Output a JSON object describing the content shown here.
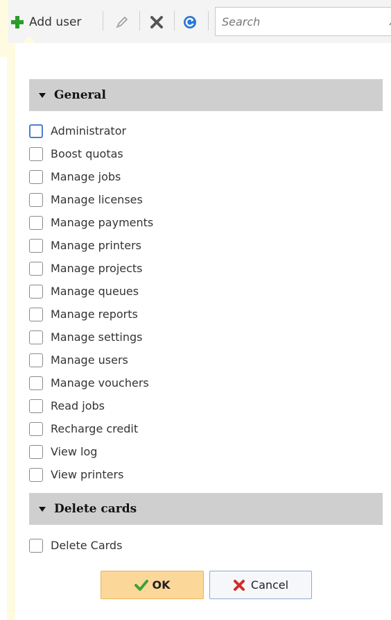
{
  "toolbar": {
    "add_user_label": "Add user",
    "search_placeholder": "Search",
    "icons": [
      "plus-icon",
      "pencil-icon",
      "delete-x-icon",
      "refresh-icon",
      "search-icon"
    ],
    "colors": {
      "plus": "#2a9d2a",
      "delete": "#555555",
      "refresh": "#2b78d6"
    }
  },
  "dialog": {
    "sections": [
      {
        "title": "General",
        "permissions": [
          "Administrator",
          "Boost quotas",
          "Manage jobs",
          "Manage licenses",
          "Manage payments",
          "Manage printers",
          "Manage projects",
          "Manage queues",
          "Manage reports",
          "Manage settings",
          "Manage users",
          "Manage vouchers",
          "Read jobs",
          "Recharge credit",
          "View log",
          "View printers"
        ]
      },
      {
        "title": "Delete cards",
        "permissions": [
          "Delete Cards"
        ]
      }
    ],
    "ok_label": "OK",
    "cancel_label": "Cancel",
    "colors": {
      "ok_bg": "#fcd79a",
      "checkmark": "#3aa23a",
      "cancel_x": "#d42a2a",
      "header_bg": "#cfcfcf",
      "panel_tint": "#fffbe0"
    }
  }
}
